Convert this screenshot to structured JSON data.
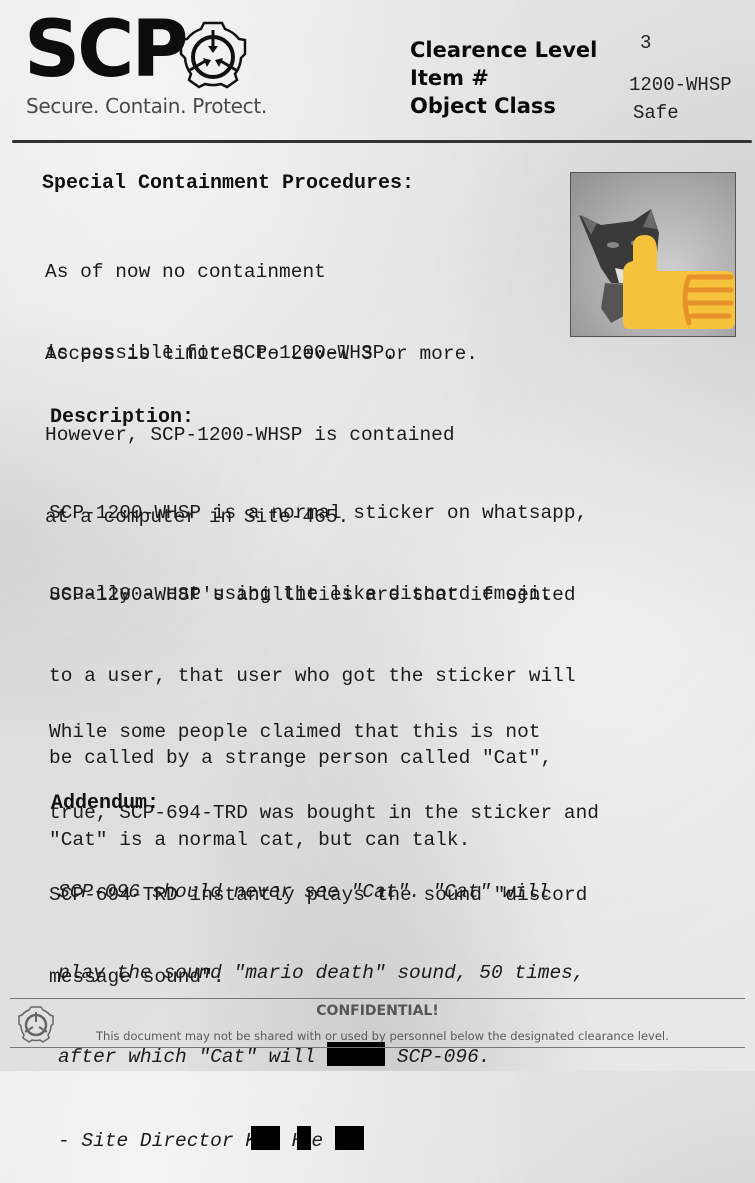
{
  "header": {
    "logo_text": "SCP",
    "tagline": "Secure. Contain. Protect.",
    "fields": [
      {
        "label": "Clearence Level",
        "value": "3"
      },
      {
        "label": "Item #",
        "value": "1200-WHSP"
      },
      {
        "label": "Object Class",
        "value": "Safe"
      }
    ]
  },
  "containment": {
    "heading": "Special Containment Procedures:",
    "lines": [
      "As of now no containment",
      "is possible for SCP-1200-WHSP.",
      "However, SCP-1200-WHSP is contained",
      "at a computer in Site-465."
    ],
    "access": "Access is limited to Level 3 or more."
  },
  "image": {
    "alt": "cat with thumbs up emoji sticker",
    "icon": "thumbs-up-icon",
    "accent_color": "#f5c33b",
    "outline_color": "#e8912c"
  },
  "description": {
    "heading": "Description:",
    "paragraphs": [
      [
        "SCP-1200-WHSP is a normal sticker on whatsapp,",
        "usually a cat using the like discord emoji."
      ],
      [
        "SCP-1200-WHSP's abillities are that if sented",
        "to a user, that user who got the sticker will",
        "be called by a strange person called \"Cat\",",
        "\"Cat\" is a normal cat, but can talk."
      ],
      [
        "While some people claimed that this is not",
        "true, SCP-694-TRD was bought in the sticker and",
        "SCP-694-TRD instantly plays the sound \"discord",
        "message sound\"."
      ]
    ]
  },
  "addendum": {
    "heading": "Addendum:",
    "line1": "SCP-096 should never see \"Cat\". \"Cat\" will",
    "line2": "play the sound \"mario death\" sound, 50 times,",
    "line3_a": "after which \"Cat\" will ",
    "line3_b": " SCP-096.",
    "sig_a": "- Site Director K",
    "sig_b": " H",
    "sig_c": "e "
  },
  "footer": {
    "title": "CONFIDENTIAL!",
    "notice": "This document may not be shared with or used by personnel below the designated clearance level."
  }
}
